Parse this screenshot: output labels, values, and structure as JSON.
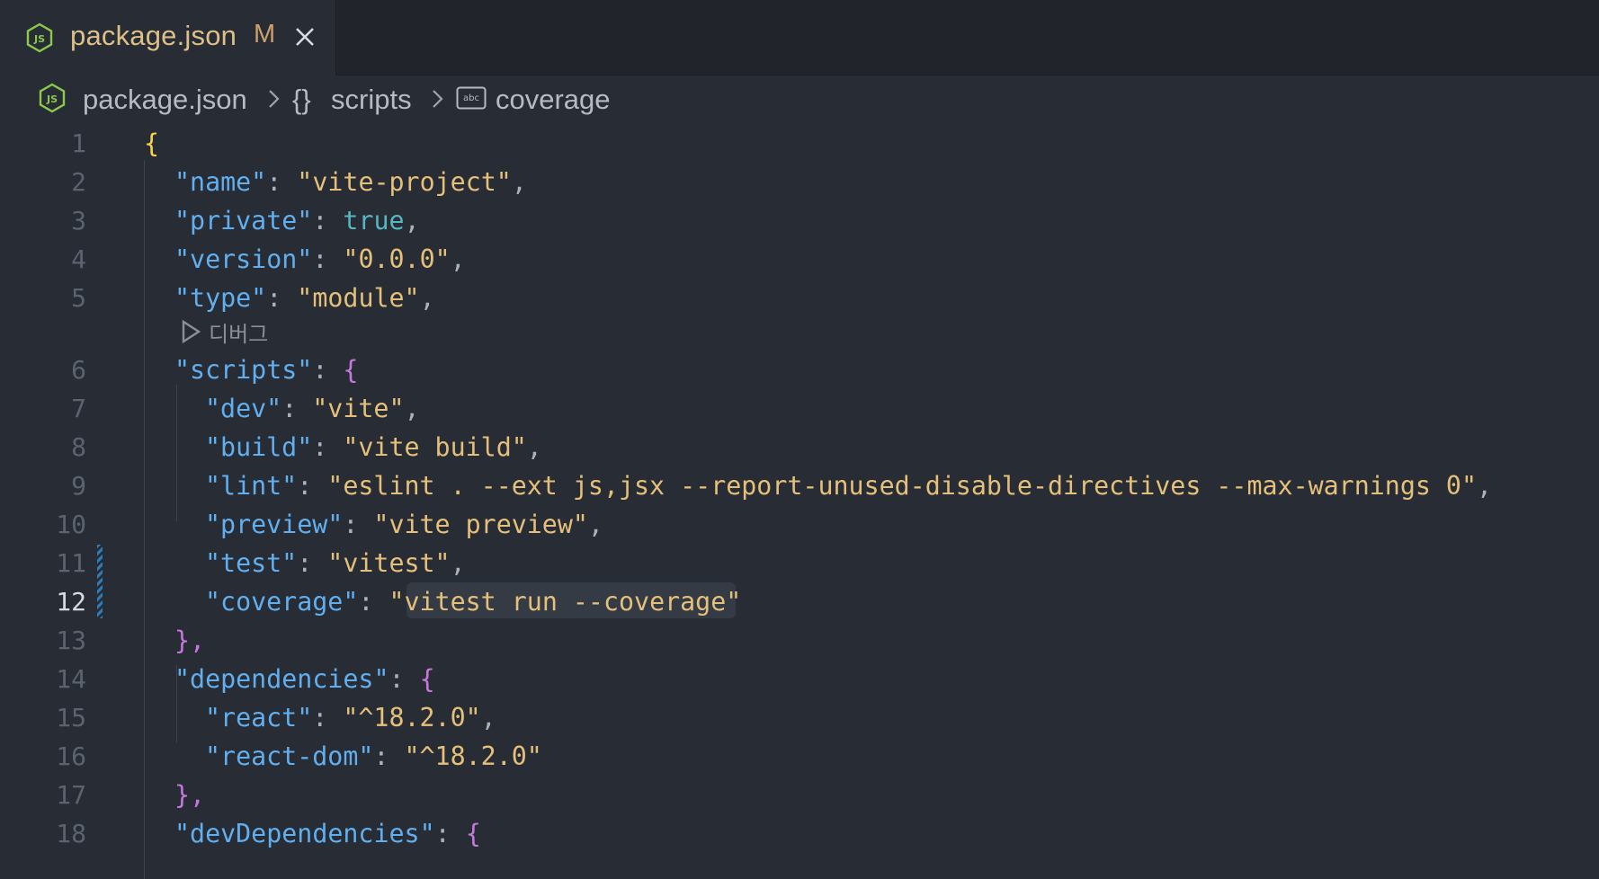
{
  "tab": {
    "filename": "package.json",
    "status": "M",
    "icon": "nodejs-icon",
    "close_icon": "close-icon"
  },
  "breadcrumb": {
    "file": "package.json",
    "section_icon": "braces-icon",
    "section": "scripts",
    "leaf_icon": "abc-string-icon",
    "leaf": "coverage",
    "braces": "{}"
  },
  "codelens": {
    "icon": "play-icon",
    "label": "디버그"
  },
  "colors": {
    "background": "#282c34",
    "tabbar": "#21252b",
    "key": "#61afef",
    "string": "#e5c07b",
    "bool": "#56b6c2",
    "brace_outer": "#f7d24a",
    "brace_inner": "#c678dd",
    "modified_accent": "#2f7ab8"
  },
  "editor": {
    "active_line": "12",
    "lines": [
      {
        "n": "1"
      },
      {
        "n": "2",
        "key": "\"name\"",
        "val": "\"vite-project\"",
        "tail": ","
      },
      {
        "n": "3",
        "key": "\"private\"",
        "val": "true",
        "tail": ","
      },
      {
        "n": "4",
        "key": "\"version\"",
        "val": "\"0.0.0\"",
        "tail": ","
      },
      {
        "n": "5",
        "key": "\"type\"",
        "val": "\"module\"",
        "tail": ","
      },
      {
        "n": "6",
        "key": "\"scripts\"",
        "open": "{"
      },
      {
        "n": "7",
        "key": "\"dev\"",
        "val": "\"vite\"",
        "tail": ","
      },
      {
        "n": "8",
        "key": "\"build\"",
        "val": "\"vite build\"",
        "tail": ","
      },
      {
        "n": "9",
        "key": "\"lint\"",
        "val": "\"eslint . --ext js,jsx --report-unused-disable-directives --max-warnings 0\"",
        "tail": ","
      },
      {
        "n": "10",
        "key": "\"preview\"",
        "val": "\"vite preview\"",
        "tail": ","
      },
      {
        "n": "11",
        "key": "\"test\"",
        "val": "\"vitest\"",
        "tail": ","
      },
      {
        "n": "12",
        "key": "\"coverage\"",
        "val": "\"vitest run --coverage\""
      },
      {
        "n": "13",
        "close": "},"
      },
      {
        "n": "14",
        "key": "\"dependencies\"",
        "open": "{"
      },
      {
        "n": "15",
        "key": "\"react\"",
        "val": "\"^18.2.0\"",
        "tail": ","
      },
      {
        "n": "16",
        "key": "\"react-dom\"",
        "val": "\"^18.2.0\""
      },
      {
        "n": "17",
        "close": "},"
      },
      {
        "n": "18",
        "key": "\"devDependencies\"",
        "open": "{"
      }
    ],
    "first_brace": "{",
    "colon": ": "
  }
}
